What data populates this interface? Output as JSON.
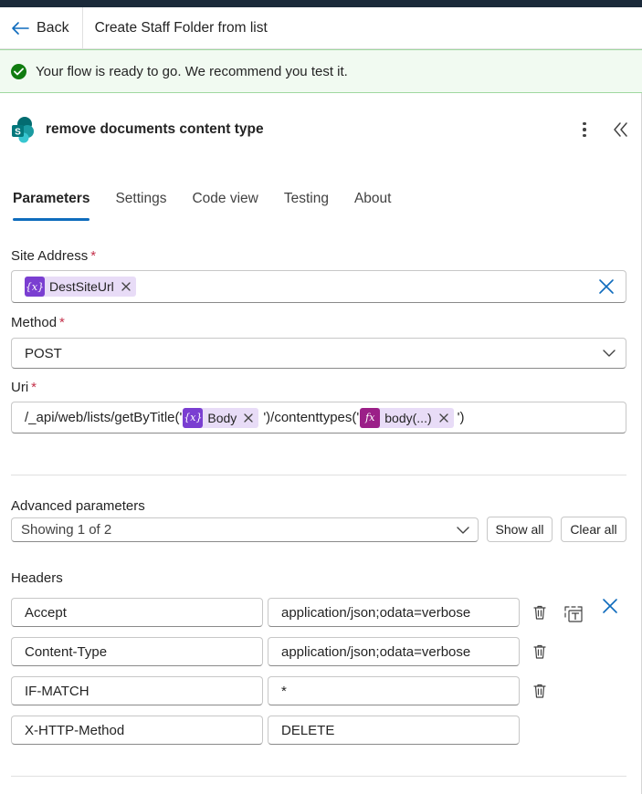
{
  "header": {
    "back_label": "Back",
    "flow_title": "Create Staff Folder from list"
  },
  "banner": {
    "message": "Your flow is ready to go. We recommend you test it."
  },
  "action": {
    "title": "remove documents content type"
  },
  "tabs": [
    {
      "label": "Parameters",
      "active": true
    },
    {
      "label": "Settings",
      "active": false
    },
    {
      "label": "Code view",
      "active": false
    },
    {
      "label": "Testing",
      "active": false
    },
    {
      "label": "About",
      "active": false
    }
  ],
  "site_address": {
    "label": "Site Address",
    "required_mark": "*",
    "token_label": "DestSiteUrl",
    "token_icon": "{x}"
  },
  "method": {
    "label": "Method",
    "required_mark": "*",
    "value": "POST"
  },
  "uri": {
    "label": "Uri",
    "required_mark": "*",
    "text_1": "/_api/web/lists/getByTitle('",
    "token_1_label": "Body",
    "token_1_icon": "{x}",
    "text_2": "')/contenttypes('",
    "token_2_label": "body(...)",
    "token_2_icon": "fx",
    "text_3": "')"
  },
  "advanced": {
    "label": "Advanced parameters",
    "select_value": "Showing 1 of 2",
    "show_all": "Show all",
    "clear_all": "Clear all"
  },
  "headers": {
    "label": "Headers",
    "rows": [
      {
        "key": "Accept",
        "value": "application/json;odata=verbose"
      },
      {
        "key": "Content-Type",
        "value": "application/json;odata=verbose"
      },
      {
        "key": "IF-MATCH",
        "value": "*"
      },
      {
        "key": "X-HTTP-Method",
        "value": "DELETE"
      }
    ]
  },
  "colors": {
    "accent": "#0f6cbd",
    "success": "#107c10",
    "token_variable": "#7a3ed1",
    "token_expression": "#9b1f88",
    "token_bg": "#e8dcf7",
    "required": "#c4314b"
  }
}
